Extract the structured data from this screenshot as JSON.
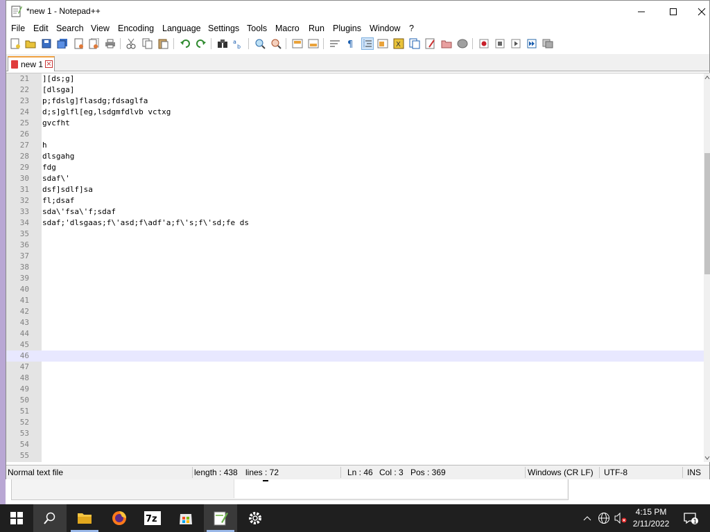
{
  "window": {
    "title": "*new 1 - Notepad++"
  },
  "menu": [
    "File",
    "Edit",
    "Search",
    "View",
    "Encoding",
    "Language",
    "Settings",
    "Tools",
    "Macro",
    "Run",
    "Plugins",
    "Window",
    "?"
  ],
  "toolbar": {
    "icons": [
      "new-file-icon",
      "open-file-icon",
      "save-icon",
      "save-all-icon",
      "close-icon",
      "close-all-icon",
      "print-icon",
      "cut-icon",
      "copy-icon",
      "paste-icon",
      "undo-icon",
      "redo-icon",
      "find-icon",
      "replace-icon",
      "zoom-in-icon",
      "zoom-out-icon",
      "sync-vertical-icon",
      "sync-horizontal-icon",
      "word-wrap-icon",
      "show-all-chars-icon",
      "indent-guide-icon",
      "udl-icon",
      "doc-map-icon",
      "function-list-icon",
      "folder-workspace-icon",
      "monitoring-icon",
      "record-macro-icon",
      "stop-macro-icon",
      "play-macro-icon",
      "run-macro-multiple-icon",
      "save-macro-icon"
    ],
    "active_icon": "indent-guide-icon"
  },
  "tabs": [
    {
      "label": "new 1",
      "modified": true
    }
  ],
  "editor": {
    "current_line": 46,
    "lines": [
      {
        "n": "21",
        "text": "][ds;g]"
      },
      {
        "n": "22",
        "text": "[dlsga]"
      },
      {
        "n": "23",
        "text": "p;fdslg]flasdg;fdsaglfa"
      },
      {
        "n": "24",
        "text": "d;s]glfl[eg,lsdgmfdlvb vctxg"
      },
      {
        "n": "25",
        "text": "gvcfht"
      },
      {
        "n": "26",
        "text": ""
      },
      {
        "n": "27",
        "text": "h"
      },
      {
        "n": "28",
        "text": "dlsgahg"
      },
      {
        "n": "29",
        "text": "fdg"
      },
      {
        "n": "30",
        "text": "sdaf\\'"
      },
      {
        "n": "31",
        "text": "dsf]sdlf]sa"
      },
      {
        "n": "32",
        "text": "fl;dsaf"
      },
      {
        "n": "33",
        "text": "sda\\'fsa\\'f;sdaf"
      },
      {
        "n": "34",
        "text": "sdaf;'dlsgaas;f\\'asd;f\\adf'a;f\\'s;f\\'sd;fe ds"
      },
      {
        "n": "35",
        "text": ""
      },
      {
        "n": "36",
        "text": ""
      },
      {
        "n": "37",
        "text": ""
      },
      {
        "n": "38",
        "text": ""
      },
      {
        "n": "39",
        "text": ""
      },
      {
        "n": "40",
        "text": ""
      },
      {
        "n": "41",
        "text": ""
      },
      {
        "n": "42",
        "text": ""
      },
      {
        "n": "43",
        "text": ""
      },
      {
        "n": "44",
        "text": ""
      },
      {
        "n": "45",
        "text": ""
      },
      {
        "n": "46",
        "text": ""
      },
      {
        "n": "47",
        "text": ""
      },
      {
        "n": "48",
        "text": ""
      },
      {
        "n": "49",
        "text": ""
      },
      {
        "n": "50",
        "text": ""
      },
      {
        "n": "51",
        "text": ""
      },
      {
        "n": "52",
        "text": ""
      },
      {
        "n": "53",
        "text": ""
      },
      {
        "n": "54",
        "text": ""
      },
      {
        "n": "55",
        "text": ""
      }
    ]
  },
  "status": {
    "file_type": "Normal text file",
    "length": "length : 438",
    "lines": "lines : 72",
    "ln": "Ln : 46",
    "col": "Col : 3",
    "pos": "Pos : 369",
    "eol": "Windows (CR LF)",
    "encoding": "UTF-8",
    "mode": "INS"
  },
  "taskbar": {
    "apps": [
      "start-icon",
      "search-icon",
      "file-explorer-icon",
      "firefox-icon",
      "7zip-icon",
      "store-icon",
      "notepadpp-icon",
      "settings-icon"
    ],
    "active_app": "notepadpp-icon",
    "tray_icons": [
      "chevron-up-icon",
      "network-icon",
      "volume-muted-icon"
    ],
    "time": "4:15 PM",
    "date": "2/11/2022",
    "notification_count": "1"
  },
  "colors": {
    "current_line": "#e8e8ff",
    "gutter": "#e4e4e4",
    "tab_accent": "#f0a040",
    "taskbar": "#1f1f1f"
  }
}
